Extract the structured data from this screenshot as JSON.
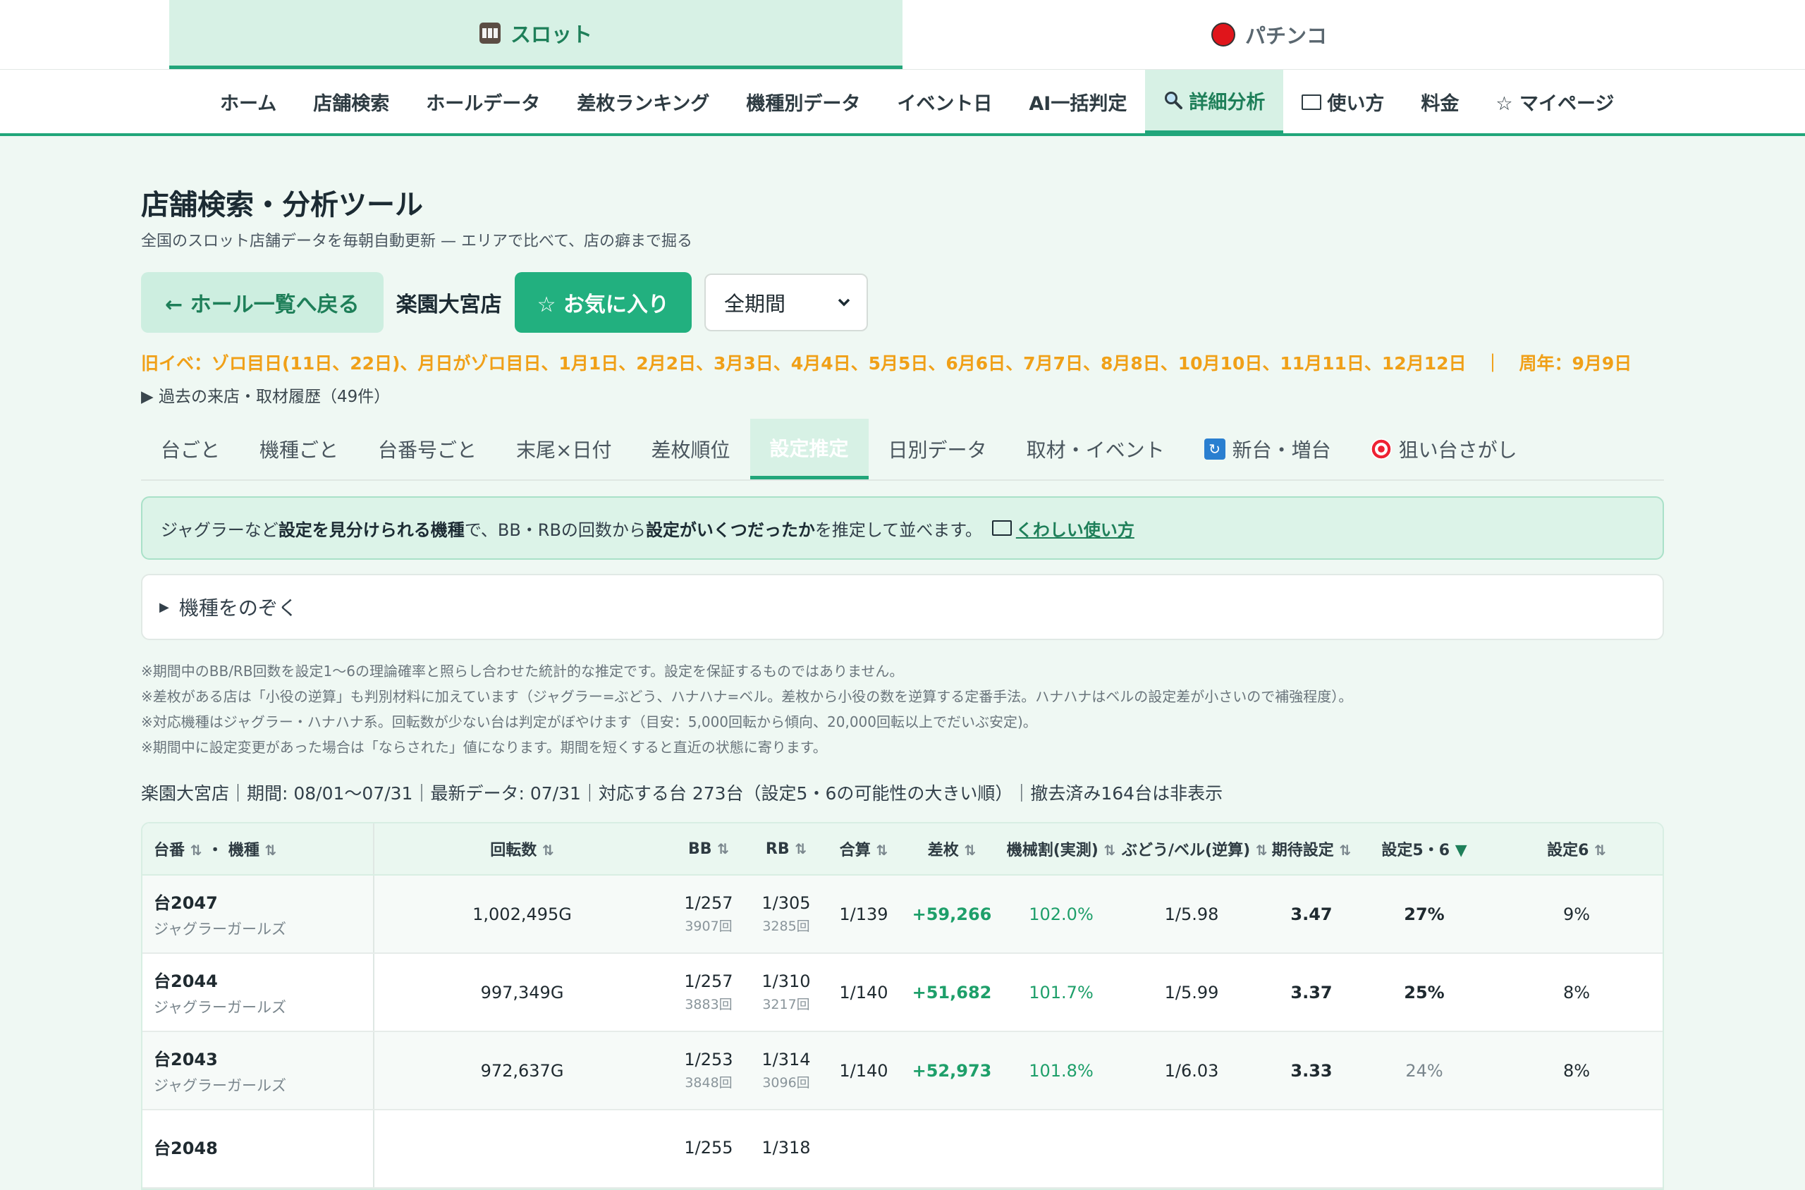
{
  "mode_tabs": [
    {
      "label": "スロット",
      "icon": "slot-machine-icon"
    },
    {
      "label": "パチンコ",
      "icon": "red-ball-icon"
    }
  ],
  "nav": {
    "items": [
      "ホーム",
      "店舗検索",
      "ホールデータ",
      "差枚ランキング",
      "機種別データ",
      "イベント日",
      "AI一括判定",
      "詳細分析",
      "使い方",
      "料金",
      "☆ マイページ"
    ],
    "active_index": 7
  },
  "page": {
    "title": "店舗検索・分析ツール",
    "subtitle": "全国のスロット店舗データを毎朝自動更新 — エリアで比べて、店の癖まで掘る"
  },
  "toolbar": {
    "back_label": "← ホール一覧へ戻る",
    "store_name": "楽園大宮店",
    "fav_label": "☆ お気に入り",
    "period_value": "全期間"
  },
  "events": {
    "text": "旧イベ：ゾロ目日(11日、22日)、月日がゾロ目日、1月1日、2月2日、3月3日、4月4日、5月5日、6月6日、7月7日、8月8日、10月10日、11月11日、12月12日　｜　周年：9月9日"
  },
  "history_label": "▶ 過去の来店・取材履歴（49件）",
  "subtabs": {
    "items": [
      "台ごと",
      "機種ごと",
      "台番号ごと",
      "末尾×日付",
      "差枚順位",
      "設定推定",
      "日別データ",
      "取材・イベント",
      "新台・増台",
      "狙い台さがし"
    ],
    "active_index": 5
  },
  "info": {
    "t1": "ジャグラーなど",
    "b1": "設定を見分けられる機種",
    "t2": "で、BB・RBの回数から",
    "b2": "設定がいくつだったか",
    "t3": "を推定して並べます。",
    "link": "くわしい使い方"
  },
  "exclude_label": "機種をのぞく",
  "notes": [
    "※期間中のBB/RB回数を設定1〜6の理論確率と照らし合わせた統計的な推定です。設定を保証するものではありません。",
    "※差枚がある店は「小役の逆算」も判別材料に加えています（ジャグラー=ぶどう、ハナハナ=ベル。差枚から小役の数を逆算する定番手法。ハナハナはベルの設定差が小さいので補強程度）。",
    "※対応機種はジャグラー・ハナハナ系。回転数が少ない台は判定がぼやけます（目安：5,000回転から傾向、20,000回転以上でだいぶ安定)。",
    "※期間中に設定変更があった場合は「ならされた」値になります。期間を短くすると直近の状態に寄ります。"
  ],
  "summary": "楽園大宮店｜期間: 08/01〜07/31｜最新データ: 07/31｜対応する台 273台（設定5・6の可能性の大きい順）｜撤去済み164台は非表示",
  "table": {
    "headers": {
      "machine_a": "台番",
      "machine_sep": "・",
      "machine_b": "機種",
      "spins": "回転数",
      "bb": "BB",
      "rb": "RB",
      "total": "合算",
      "diff": "差枚",
      "payout": "機械割(実測)",
      "grape": "ぶどう/ベル(逆算)",
      "expected": "期待設定",
      "s56": "設定5・6",
      "s6": "設定6"
    },
    "rows": [
      {
        "no": "台2047",
        "name": "ジャグラーガールズ",
        "spins": "1,002,495G",
        "bb": "1/257",
        "bb_cnt": "3907回",
        "rb": "1/305",
        "rb_cnt": "3285回",
        "total": "1/139",
        "diff": "+59,266",
        "payout": "102.0%",
        "grape": "1/5.98",
        "expected": "3.47",
        "s56": "27%",
        "s56_bold": true,
        "s6": "9%"
      },
      {
        "no": "台2044",
        "name": "ジャグラーガールズ",
        "spins": "997,349G",
        "bb": "1/257",
        "bb_cnt": "3883回",
        "rb": "1/310",
        "rb_cnt": "3217回",
        "total": "1/140",
        "diff": "+51,682",
        "payout": "101.7%",
        "grape": "1/5.99",
        "expected": "3.37",
        "s56": "25%",
        "s56_bold": true,
        "s6": "8%"
      },
      {
        "no": "台2043",
        "name": "ジャグラーガールズ",
        "spins": "972,637G",
        "bb": "1/253",
        "bb_cnt": "3848回",
        "rb": "1/314",
        "rb_cnt": "3096回",
        "total": "1/140",
        "diff": "+52,973",
        "payout": "101.8%",
        "grape": "1/6.03",
        "expected": "3.33",
        "s56": "24%",
        "s56_bold": false,
        "s6": "8%"
      },
      {
        "no": "台2048",
        "name": "",
        "spins": "",
        "bb": "1/255",
        "bb_cnt": "",
        "rb": "1/318",
        "rb_cnt": "",
        "total": "",
        "diff": "",
        "payout": "",
        "grape": "",
        "expected": "",
        "s56": "",
        "s56_bold": false,
        "s6": ""
      }
    ]
  },
  "colors": {
    "accent": "#21a67a",
    "event": "#f0a018",
    "background": "#eff8f3"
  }
}
